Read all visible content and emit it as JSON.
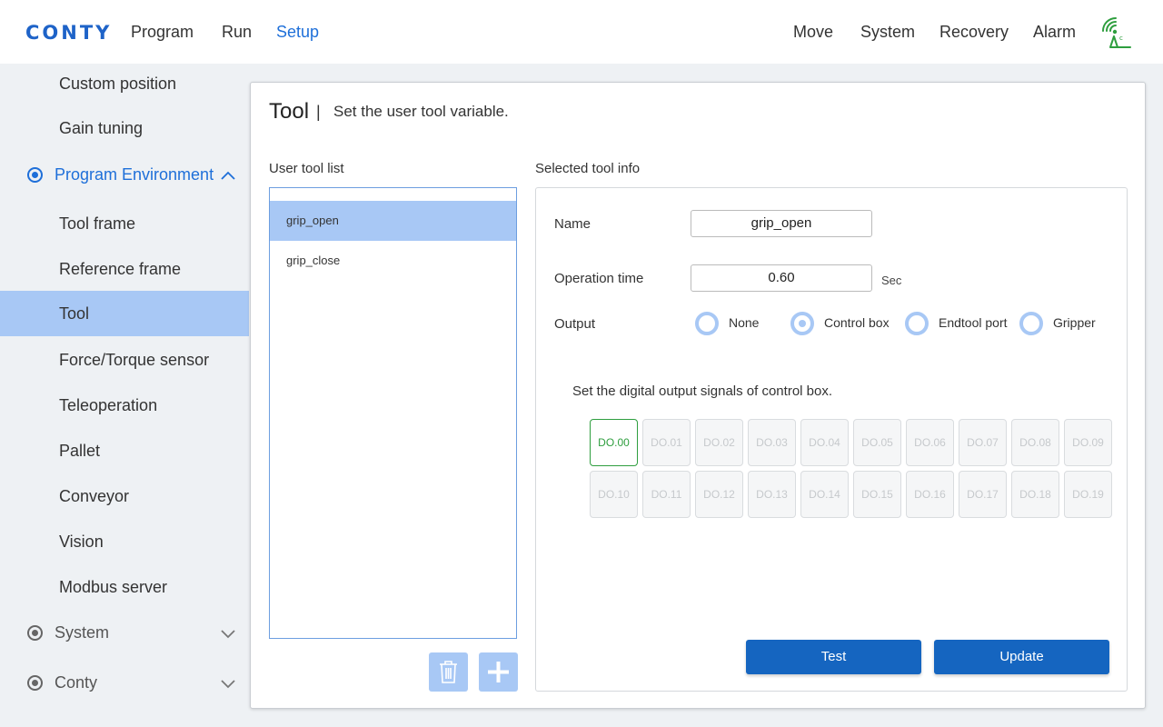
{
  "app": {
    "logo": "CONTY",
    "nav_left": [
      "Program",
      "Run",
      "Setup"
    ],
    "active_nav": "Setup",
    "nav_right": [
      "Move",
      "System",
      "Recovery",
      "Alarm"
    ],
    "status_icon": "wifi-signal-icon"
  },
  "sidebar": {
    "items_top": [
      "Custom position",
      "Gain tuning"
    ],
    "category_open": "Program Environment",
    "sub_items": [
      "Tool frame",
      "Reference frame",
      "Tool",
      "Force/Torque sensor",
      "Teleoperation",
      "Pallet",
      "Conveyor",
      "Vision",
      "Modbus server"
    ],
    "active_item": "Tool",
    "categories_closed": [
      "System",
      "Conty"
    ]
  },
  "panel": {
    "title": "Tool",
    "separator": "|",
    "description": "Set the user tool variable.",
    "list_label": "User tool list",
    "tools": [
      "grip_open",
      "grip_close"
    ],
    "selected_tool": "grip_open",
    "info_label": "Selected tool info",
    "name_label": "Name",
    "name_value": "grip_open",
    "op_time_label": "Operation time",
    "op_time_value": "0.60",
    "op_time_unit": "Sec",
    "output_label": "Output",
    "output_options": [
      "None",
      "Control box",
      "Endtool port",
      "Gripper"
    ],
    "output_selected": "Control box",
    "do_hint": "Set the digital output signals of control box.",
    "do_signals": [
      "DO.00",
      "DO.01",
      "DO.02",
      "DO.03",
      "DO.04",
      "DO.05",
      "DO.06",
      "DO.07",
      "DO.08",
      "DO.09",
      "DO.10",
      "DO.11",
      "DO.12",
      "DO.13",
      "DO.14",
      "DO.15",
      "DO.16",
      "DO.17",
      "DO.18",
      "DO.19"
    ],
    "do_active": [
      "DO.00"
    ],
    "test_label": "Test",
    "update_label": "Update",
    "accent_color": "#1565c0",
    "selection_color": "#a8c8f5",
    "active_signal_color": "#2e9e3e"
  }
}
